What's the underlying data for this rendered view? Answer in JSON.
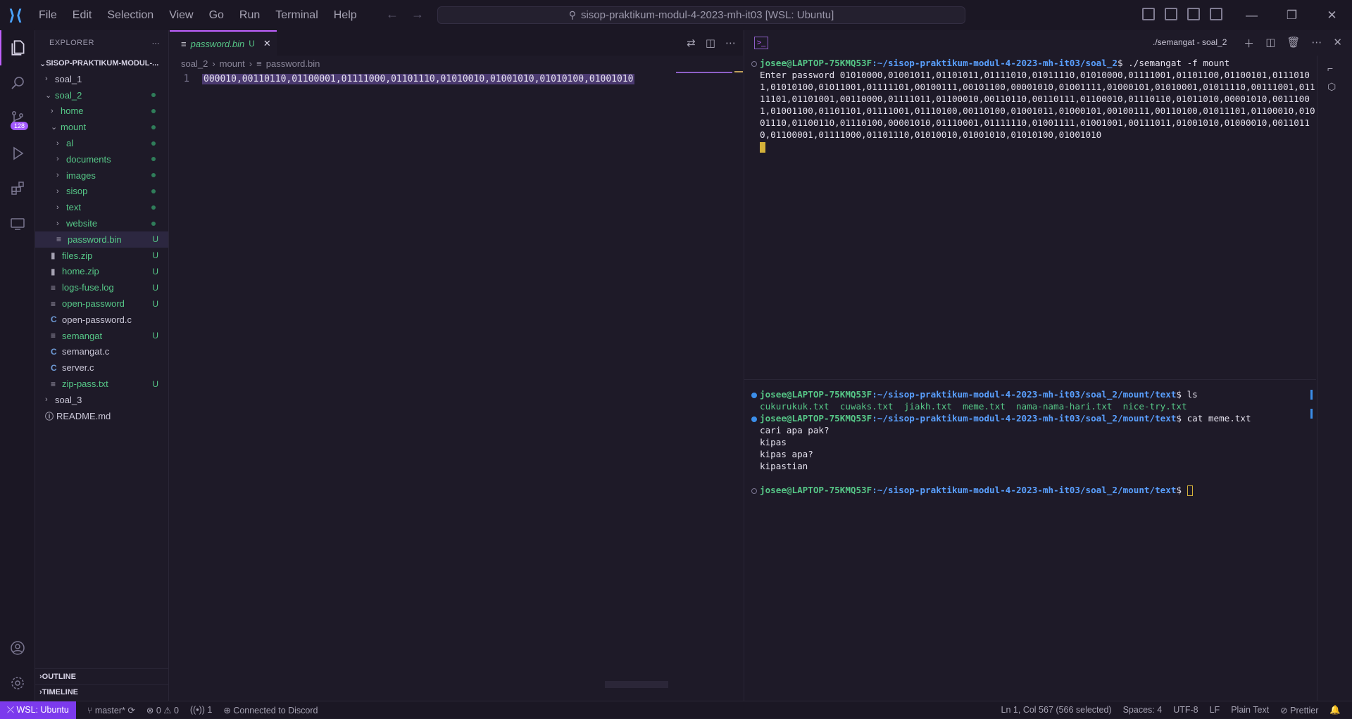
{
  "titlebar": {
    "menu": [
      "File",
      "Edit",
      "Selection",
      "View",
      "Go",
      "Run",
      "Terminal",
      "Help"
    ],
    "search_text": "sisop-praktikum-modul-4-2023-mh-it03 [WSL: Ubuntu]"
  },
  "activitybar": {
    "scm_badge": "128"
  },
  "sidebar": {
    "title": "EXPLORER",
    "root": "SISOP-PRAKTIKUM-MODUL-...",
    "items": [
      {
        "label": "soal_1",
        "indent": 1,
        "kind": "folder",
        "open": false,
        "color": "plain",
        "status": ""
      },
      {
        "label": "soal_2",
        "indent": 1,
        "kind": "folder",
        "open": true,
        "color": "green",
        "status": "dot"
      },
      {
        "label": "home",
        "indent": 2,
        "kind": "folder",
        "open": false,
        "color": "green",
        "status": "dot"
      },
      {
        "label": "mount",
        "indent": 2,
        "kind": "folder",
        "open": true,
        "color": "green",
        "status": "dot"
      },
      {
        "label": "al",
        "indent": 3,
        "kind": "folder",
        "open": false,
        "color": "green",
        "status": "dot"
      },
      {
        "label": "documents",
        "indent": 3,
        "kind": "folder",
        "open": false,
        "color": "green",
        "status": "dot"
      },
      {
        "label": "images",
        "indent": 3,
        "kind": "folder",
        "open": false,
        "color": "green",
        "status": "dot"
      },
      {
        "label": "sisop",
        "indent": 3,
        "kind": "folder",
        "open": false,
        "color": "green",
        "status": "dot"
      },
      {
        "label": "text",
        "indent": 3,
        "kind": "folder",
        "open": false,
        "color": "green",
        "status": "dot"
      },
      {
        "label": "website",
        "indent": 3,
        "kind": "folder",
        "open": false,
        "color": "green",
        "status": "dot"
      },
      {
        "label": "password.bin",
        "indent": 3,
        "kind": "file",
        "icon": "≡",
        "color": "green",
        "status": "U",
        "selected": true
      },
      {
        "label": "files.zip",
        "indent": 2,
        "kind": "file",
        "icon": "▮",
        "color": "green",
        "status": "U"
      },
      {
        "label": "home.zip",
        "indent": 2,
        "kind": "file",
        "icon": "▮",
        "color": "green",
        "status": "U"
      },
      {
        "label": "logs-fuse.log",
        "indent": 2,
        "kind": "file",
        "icon": "≡",
        "color": "green",
        "status": "U"
      },
      {
        "label": "open-password",
        "indent": 2,
        "kind": "file",
        "icon": "≡",
        "color": "green",
        "status": "U"
      },
      {
        "label": "open-password.c",
        "indent": 2,
        "kind": "file",
        "icon": "C",
        "color": "plain",
        "status": ""
      },
      {
        "label": "semangat",
        "indent": 2,
        "kind": "file",
        "icon": "≡",
        "color": "green",
        "status": "U"
      },
      {
        "label": "semangat.c",
        "indent": 2,
        "kind": "file",
        "icon": "C",
        "color": "plain",
        "status": ""
      },
      {
        "label": "server.c",
        "indent": 2,
        "kind": "file",
        "icon": "C",
        "color": "plain",
        "status": ""
      },
      {
        "label": "zip-pass.txt",
        "indent": 2,
        "kind": "file",
        "icon": "≡",
        "color": "green",
        "status": "U"
      },
      {
        "label": "soal_3",
        "indent": 1,
        "kind": "folder",
        "open": false,
        "color": "plain",
        "status": ""
      },
      {
        "label": "README.md",
        "indent": 1,
        "kind": "file",
        "icon": "ⓘ",
        "color": "plain",
        "status": ""
      }
    ],
    "outline": "OUTLINE",
    "timeline": "TIMELINE"
  },
  "editor": {
    "tab_name": "password.bin",
    "tab_status": "U",
    "breadcrumb": [
      "soal_2",
      "mount",
      "password.bin"
    ],
    "line_number": "1",
    "line_text": "000010,00110110,01100001,01111000,01101110,01010010,01001010,01010100,01001010"
  },
  "terminal": {
    "title": "./semangat - soal_2",
    "top": {
      "user": "josee@LAPTOP-75KMQ53F",
      "path": ":~/sisop-praktikum-modul-4-2023-mh-it03/soal_2",
      "command": "$ ./semangat -f mount",
      "output": "Enter password 01010000,01001011,01101011,01111010,01011110,01010000,01111001,01101100,01100101,01110101,01010100,01011001,01111101,00100111,00101100,00001010,01001111,01000101,01010001,01011110,00111001,01111101,01101001,00110000,01111011,01100010,00110110,00110111,01100010,01110110,01011010,00001010,00111001,01001100,01101101,01111001,01110100,00110100,01001011,01000101,00100111,00110100,01011101,01100010,01001110,01100110,01110100,00001010,01110001,01111110,01001111,01001001,00111011,01001010,01000010,00110110,01100001,01111000,01101110,01010010,01001010,01010100,01001010"
    },
    "bottom": {
      "user": "josee@LAPTOP-75KMQ53F",
      "path": ":~/sisop-praktikum-modul-4-2023-mh-it03/soal_2/mount/text",
      "cmd1": "$ ls",
      "ls_output": "cukurukuk.txt  cuwaks.txt  jiakh.txt  meme.txt  nama-nama-hari.txt  nice-try.txt",
      "cmd2": "$ cat meme.txt",
      "cat_output": [
        "cari apa pak?",
        "kipas",
        "kipas apa?",
        "kipastian"
      ],
      "cmd3": "$ "
    }
  },
  "statusbar": {
    "remote": "WSL: Ubuntu",
    "branch": "master*",
    "errors": "0",
    "warnings": "0",
    "ports": "1",
    "discord": "Connected to Discord",
    "cursor": "Ln 1, Col 567 (566 selected)",
    "spaces": "Spaces: 4",
    "encoding": "UTF-8",
    "eol": "LF",
    "language": "Plain Text",
    "prettier": "Prettier"
  }
}
